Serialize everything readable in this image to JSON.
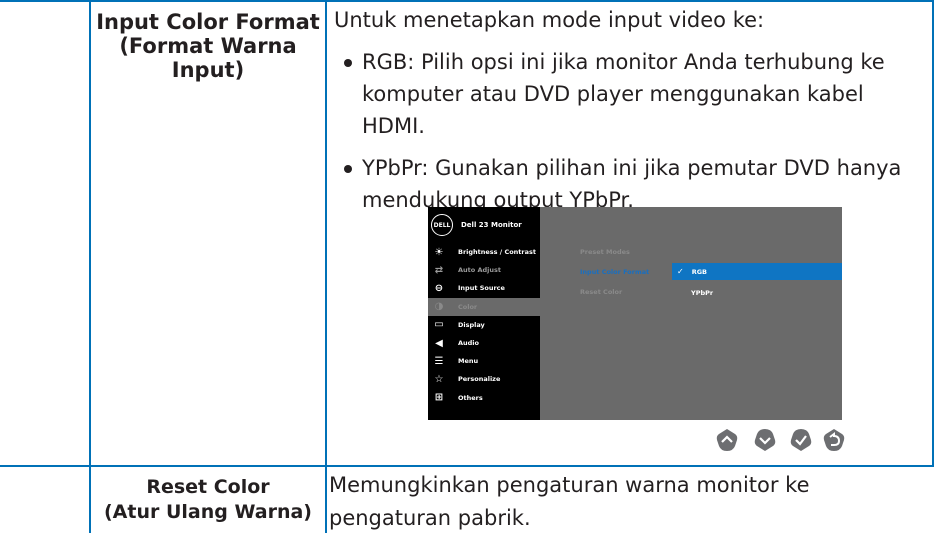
{
  "rows": [
    {
      "label": "Input Color Format (Format Warna Input)",
      "label_lines": [
        "Input Color Format",
        "(Format Warna",
        "Input)"
      ],
      "intro": "Untuk menetapkan mode input video ke:",
      "bullets": [
        "RGB: Pilih opsi ini jika monitor Anda terhubung ke komputer atau DVD player menggunakan kabel HDMI.",
        "YPbPr: Gunakan pilihan ini jika pemutar DVD hanya mendukung output YPbPr."
      ]
    },
    {
      "label_lines": [
        "Reset Color",
        "(Atur Ulang Warna)"
      ],
      "description": "Memungkinkan pengaturan warna monitor ke pengaturan pabrik."
    }
  ],
  "osd": {
    "logo": "DELL",
    "title": "Dell 23 Monitor",
    "menu": [
      {
        "label": "Brightness / Contrast",
        "icon": "brightness-icon",
        "state": "normal"
      },
      {
        "label": "Auto Adjust",
        "icon": "auto-adjust-icon",
        "state": "dim"
      },
      {
        "label": "Input Source",
        "icon": "input-source-icon",
        "state": "normal"
      },
      {
        "label": "Color",
        "icon": "color-icon",
        "state": "active"
      },
      {
        "label": "Display",
        "icon": "display-icon",
        "state": "normal"
      },
      {
        "label": "Audio",
        "icon": "audio-icon",
        "state": "normal"
      },
      {
        "label": "Menu",
        "icon": "menu-icon",
        "state": "normal"
      },
      {
        "label": "Personalize",
        "icon": "personalize-icon",
        "state": "normal"
      },
      {
        "label": "Others",
        "icon": "others-icon",
        "state": "normal"
      }
    ],
    "submenu": [
      "Preset Modes",
      "Input Color Format",
      "Reset Color"
    ],
    "options": [
      {
        "label": "RGB",
        "selected": true
      },
      {
        "label": "YPbPr",
        "selected": false
      }
    ],
    "nav_buttons": [
      "up-icon",
      "down-icon",
      "check-icon",
      "back-icon"
    ]
  },
  "colors": {
    "grid": "#0071b7",
    "osd_bg": "#6a6a6a",
    "osd_sidebar": "#000000",
    "osd_select": "#0f75c3",
    "nav_button": "#6d6e71"
  }
}
